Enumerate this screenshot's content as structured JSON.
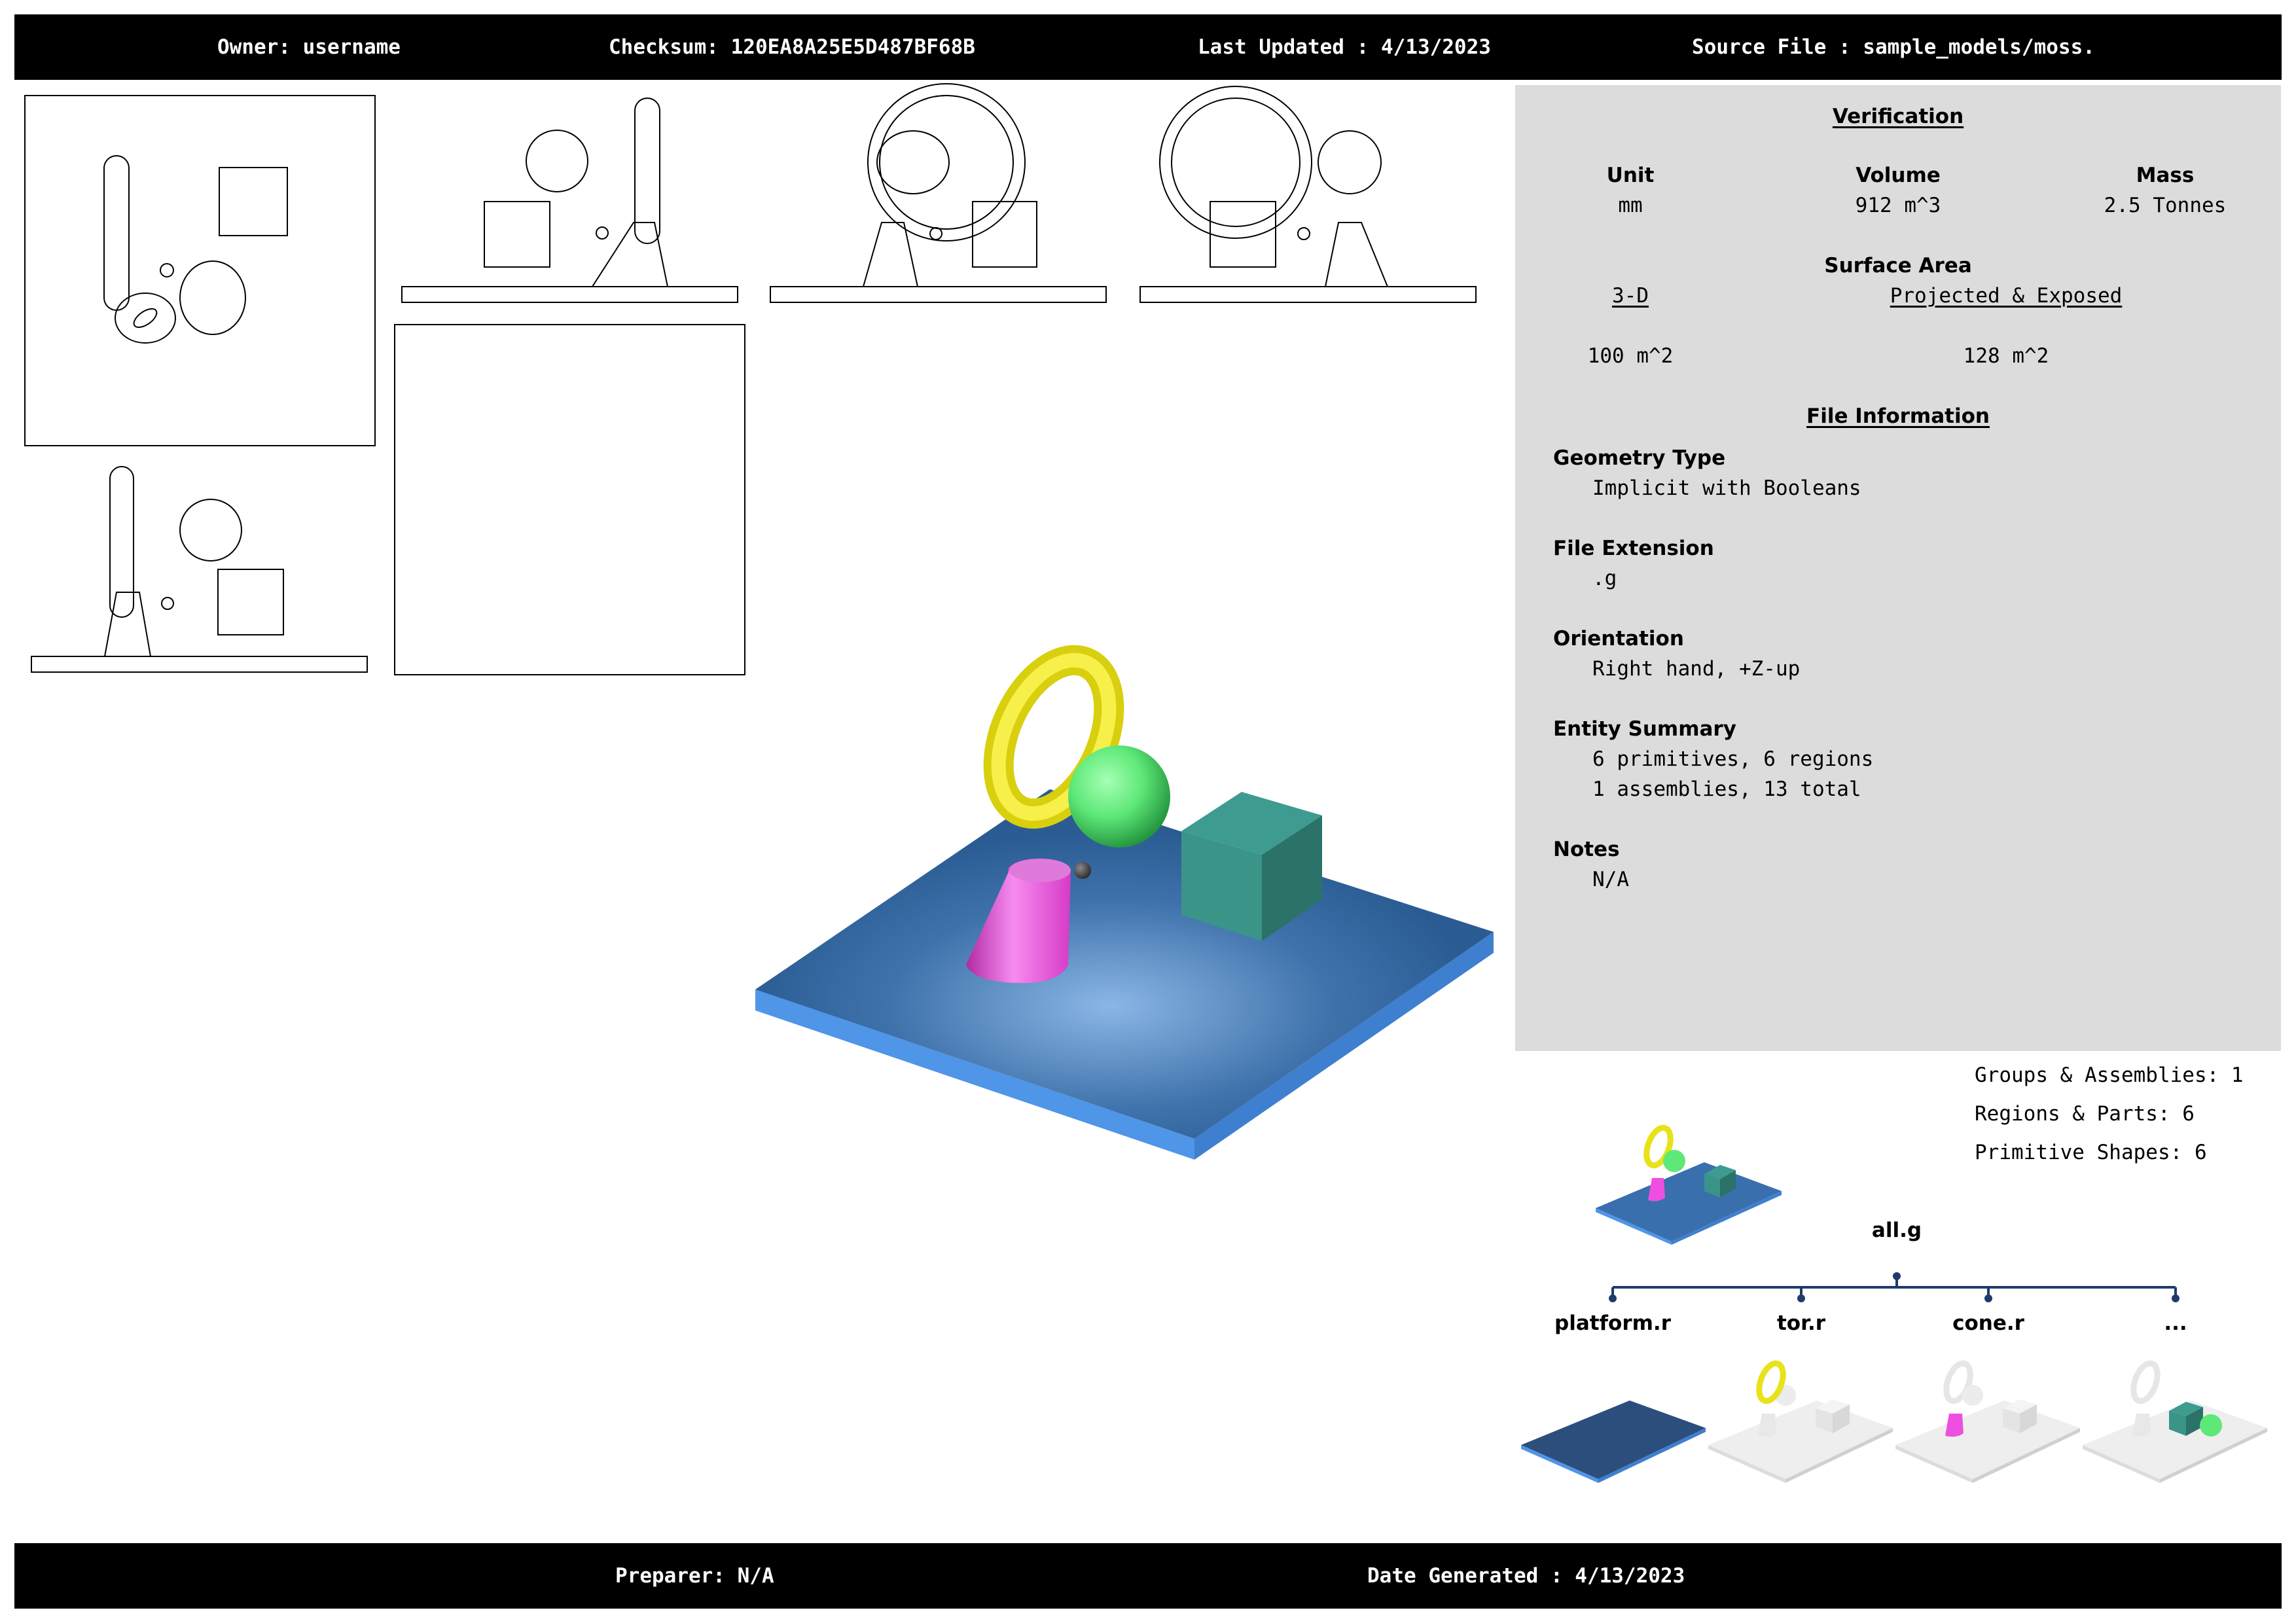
{
  "header": {
    "owner": "Owner: username",
    "checksum": "Checksum: 120EA8A25E5D487BF68B",
    "last_updated": "Last Updated : 4/13/2023",
    "source_file": "Source File : sample_models/moss."
  },
  "footer": {
    "preparer": "Preparer: N/A",
    "date_generated": "Date Generated : 4/13/2023"
  },
  "verification": {
    "title": "Verification",
    "unit_label": "Unit",
    "unit_value": "mm",
    "volume_label": "Volume",
    "volume_value": "912 m^3",
    "mass_label": "Mass",
    "mass_value": "2.5 Tonnes",
    "surface_area_label": "Surface Area",
    "sa_3d_label": "3-D",
    "sa_projected_label": "Projected & Exposed",
    "sa_3d_value": "100 m^2",
    "sa_projected_value": "128 m^2"
  },
  "file_information": {
    "title": "File Information",
    "geometry_type_label": "Geometry Type",
    "geometry_type_value": "Implicit with Booleans",
    "file_extension_label": "File Extension",
    "file_extension_value": ".g",
    "orientation_label": "Orientation",
    "orientation_value": "Right hand, +Z-up",
    "entity_summary_label": "Entity Summary",
    "entity_summary_line1": "6 primitives, 6 regions",
    "entity_summary_line2": "1 assemblies, 13 total",
    "notes_label": "Notes",
    "notes_value": "N/A"
  },
  "stats": {
    "groups": "Groups & Assemblies: 1",
    "regions": "Regions & Parts: 6",
    "primitives": "Primitive Shapes: 6"
  },
  "tree": {
    "root": "all.g",
    "children": [
      "platform.r",
      "tor.r",
      "cone.r",
      "..."
    ]
  },
  "colors": {
    "platform": "#2c5d96",
    "torus": "#e8e21a",
    "sphere": "#5ee878",
    "cube": "#2f8a7e",
    "cone": "#ef4fe0",
    "panel": "#dcdcdc",
    "tree_line": "#1f3b6b"
  }
}
